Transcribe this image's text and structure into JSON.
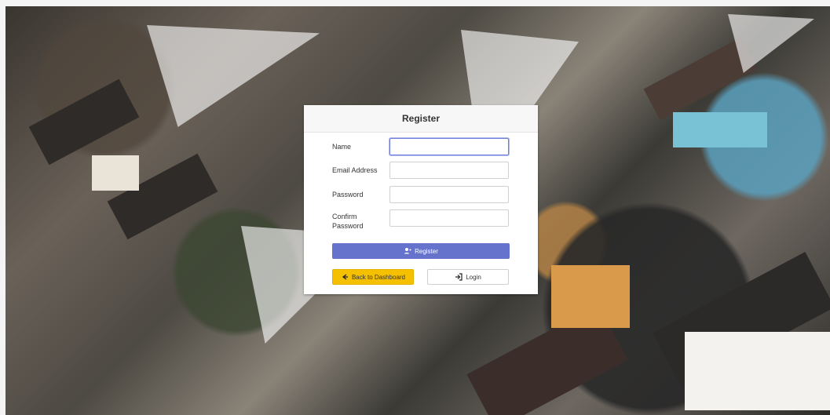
{
  "background": {
    "image_alt": "",
    "palette": [
      "#39352f",
      "#6a6158",
      "#79c2d6",
      "#d99b4b",
      "#f4f2ee"
    ]
  },
  "card": {
    "title": "Register",
    "fields": [
      {
        "label": "Name",
        "value": "",
        "placeholder": "",
        "focused": true
      },
      {
        "label": "Email Address",
        "value": "",
        "placeholder": ""
      },
      {
        "label": "Password",
        "value": "",
        "placeholder": ""
      },
      {
        "label": "Confirm Password",
        "value": "",
        "placeholder": ""
      }
    ],
    "register_button": {
      "label": "Register",
      "icon": "user-plus-icon"
    },
    "back_button": {
      "label": "Back to Dashboard",
      "icon": "arrow-left-icon"
    },
    "login_button": {
      "label": "Login",
      "icon": "sign-in-icon"
    }
  },
  "colors": {
    "primary": "#6573cc",
    "warning": "#f5c000",
    "card_header": "#f7f7f7"
  }
}
